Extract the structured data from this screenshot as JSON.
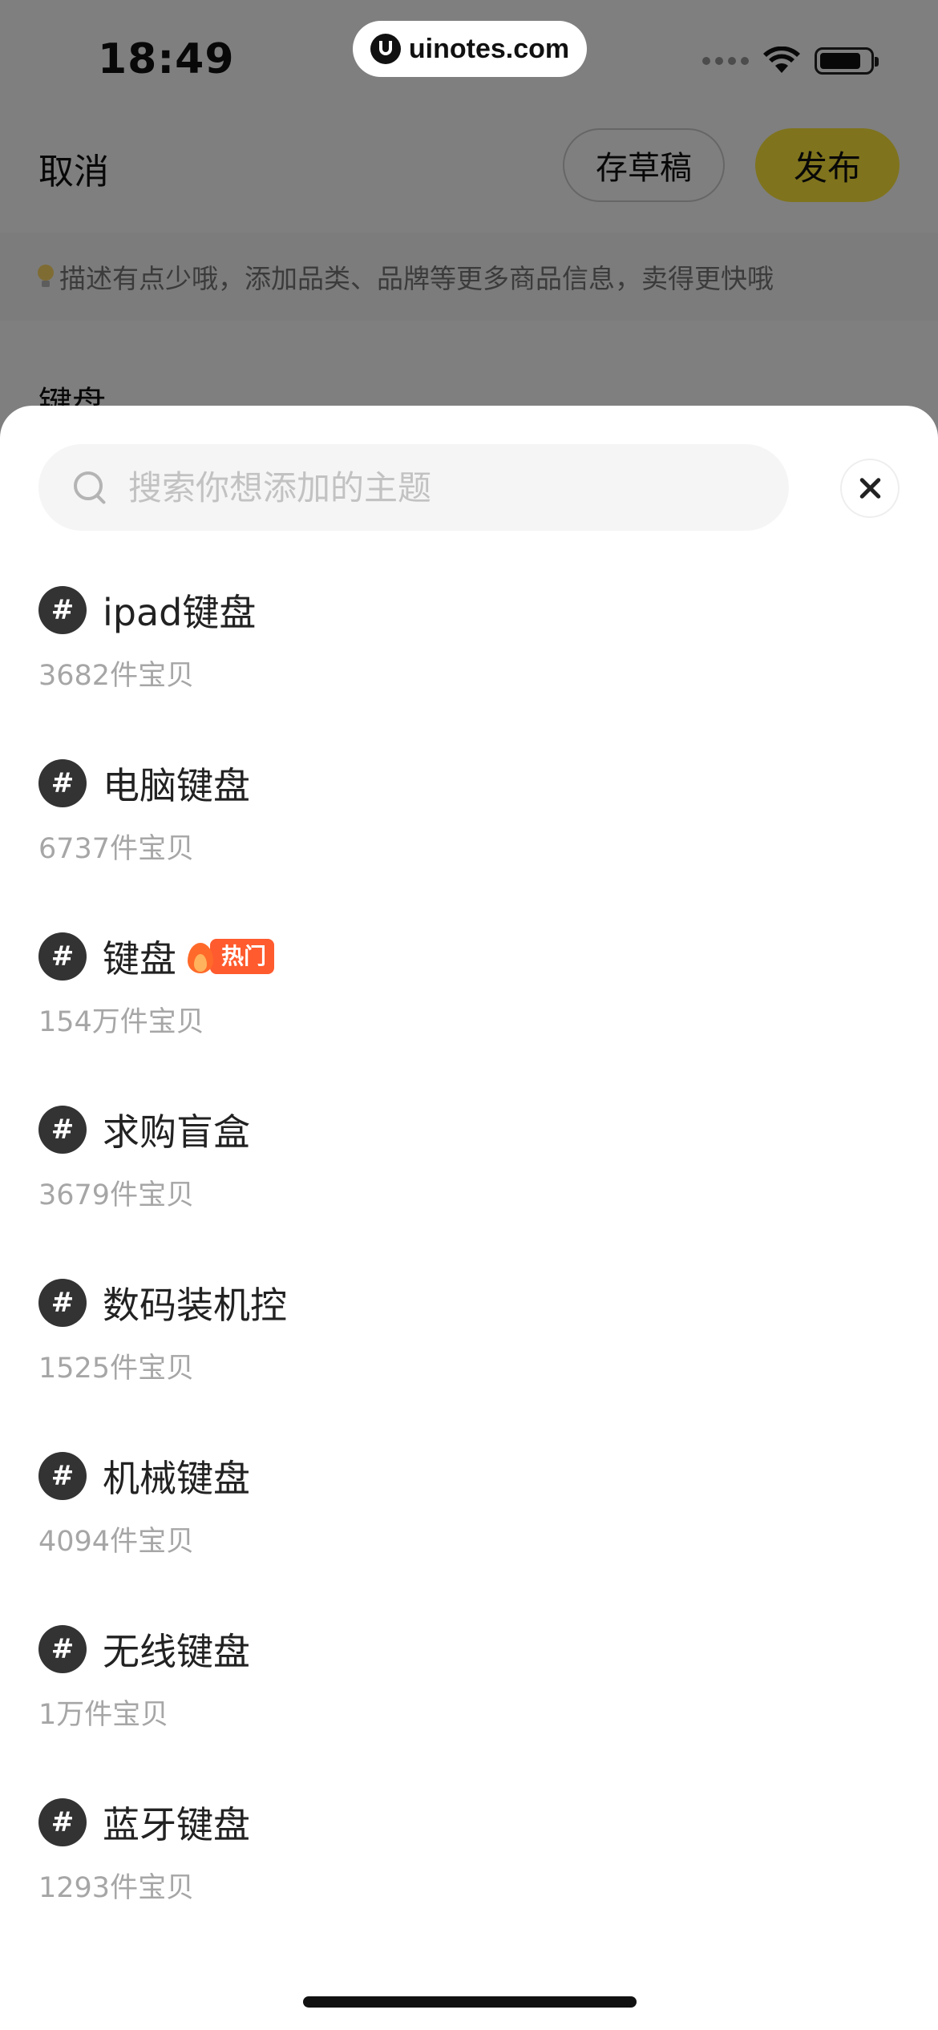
{
  "status_bar": {
    "time": "18:49",
    "watermark": "uinotes.com"
  },
  "nav": {
    "cancel_label": "取消",
    "draft_label": "存草稿",
    "publish_label": "发布"
  },
  "hint": {
    "text": "描述有点少哦，添加品类、品牌等更多商品信息，卖得更快哦"
  },
  "product": {
    "title": "键盘"
  },
  "colors": {
    "accent": "#ffe63a",
    "hot": "#ff5b2e"
  },
  "search": {
    "placeholder": "搜索你想添加的主题",
    "value": ""
  },
  "topics": [
    {
      "name": "ipad键盘",
      "count": "3682件宝贝",
      "hot": false
    },
    {
      "name": "电脑键盘",
      "count": "6737件宝贝",
      "hot": false
    },
    {
      "name": "键盘",
      "count": "154万件宝贝",
      "hot": true,
      "badge": "热门"
    },
    {
      "name": "求购盲盒",
      "count": "3679件宝贝",
      "hot": false
    },
    {
      "name": "数码装机控",
      "count": "1525件宝贝",
      "hot": false
    },
    {
      "name": "机械键盘",
      "count": "4094件宝贝",
      "hot": false
    },
    {
      "name": "无线键盘",
      "count": "1万件宝贝",
      "hot": false
    },
    {
      "name": "蓝牙键盘",
      "count": "1293件宝贝",
      "hot": false
    }
  ],
  "hash_symbol": "#"
}
